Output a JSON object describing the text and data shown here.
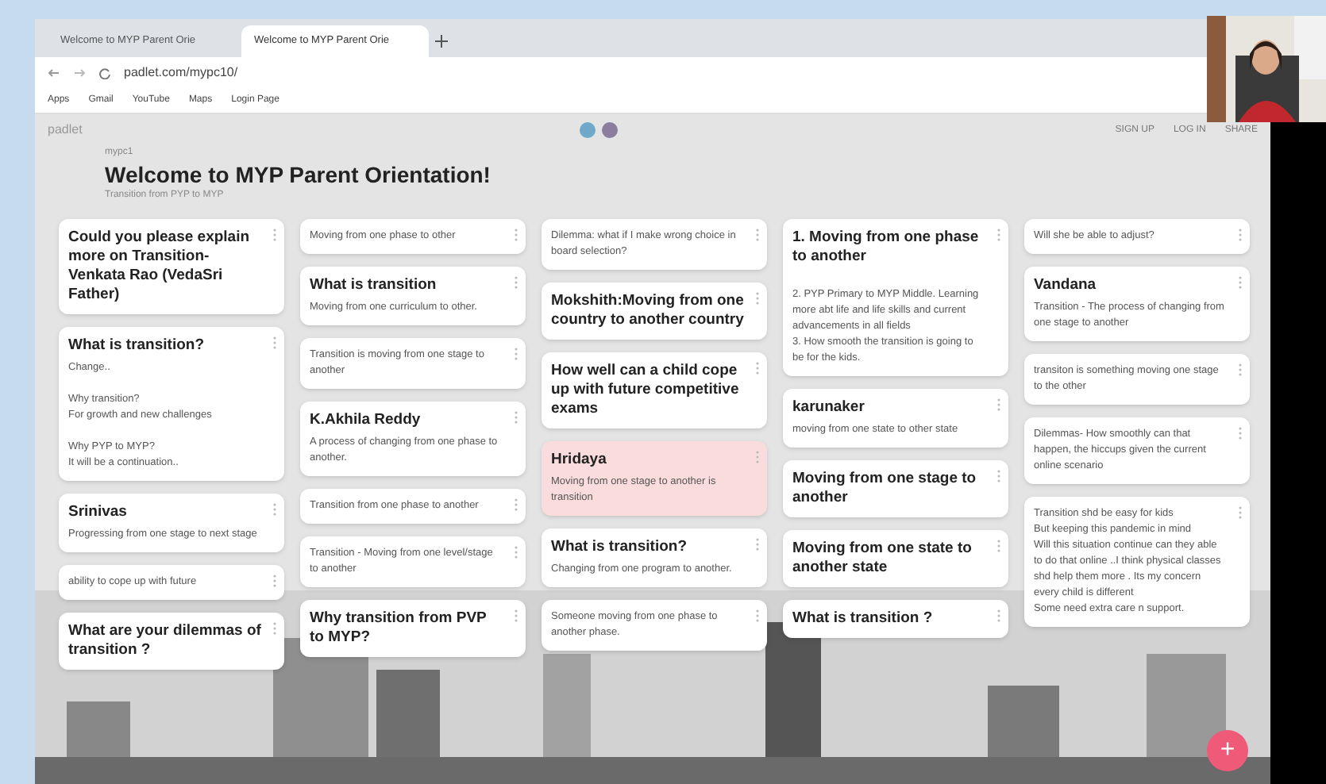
{
  "browser": {
    "tabs": [
      {
        "title": "Welcome to MYP Parent Orie",
        "selected": false
      },
      {
        "title": "Welcome to MYP Parent Orie",
        "selected": true
      }
    ],
    "address": "padlet.com/mypc10/",
    "bookmarks": [
      "Apps",
      "Gmail",
      "YouTube",
      "Maps",
      "Login Page"
    ]
  },
  "padlet": {
    "brand": "padlet",
    "actions": [
      "SIGN UP",
      "LOG IN",
      "SHARE"
    ],
    "author": "mypc1",
    "title": "Welcome to MYP Parent Orientation!",
    "subtitle": "Transition from PYP to MYP",
    "columns": [
      [
        {
          "title": "Could you please explain more on Transition-Venkata Rao (VedaSri Father)",
          "color": "#ffffff"
        },
        {
          "title": "What is transition?",
          "body": "Change..\n\nWhy transition?\nFor growth and new challenges\n\nWhy PYP to MYP?\nIt will be a continuation..",
          "color": "#ffffff"
        },
        {
          "title": "Srinivas",
          "body": "Progressing from one stage to next stage",
          "color": "#ffffff"
        },
        {
          "body": "ability to cope up with future",
          "color": "#ffffff"
        },
        {
          "title": "What are your dilemmas of transition ?",
          "color": "#ffffff"
        }
      ],
      [
        {
          "body": "Moving from one phase to other",
          "color": "#ffffff"
        },
        {
          "title": "What is transition",
          "body": "Moving from one curriculum to other.",
          "color": "#ffffff"
        },
        {
          "body": "Transition is moving from one stage to another",
          "color": "#ffffff"
        },
        {
          "title": "K.Akhila Reddy",
          "body": "A process of changing from one phase to another.",
          "color": "#ffffff"
        },
        {
          "body": "Transition from one phase to another",
          "color": "#ffffff"
        },
        {
          "body": "Transition - Moving from one level/stage to another",
          "color": "#ffffff"
        },
        {
          "title": "Why transition from PVP to MYP?",
          "color": "#ffffff"
        }
      ],
      [
        {
          "body": "Dilemma: what if I make wrong choice in board selection?",
          "color": "#ffffff"
        },
        {
          "title": "Mokshith:Moving from one country to another country",
          "color": "#ffffff"
        },
        {
          "title": "How well can a child cope up with future competitive exams",
          "color": "#ffffff"
        },
        {
          "title": "Hridaya",
          "body": "Moving from one stage to another is transition",
          "color": "#fbdcdc"
        },
        {
          "title": "What is transition?",
          "body": "Changing from one program to another.",
          "color": "#ffffff"
        },
        {
          "body": "Someone moving from one phase to another phase.",
          "color": "#ffffff"
        }
      ],
      [
        {
          "title": "1. Moving from one phase to another",
          "body": "\n2.  PYP Primary to MYP Middle. Learning more abt life and life skills and current advancements in all fields\n3. How smooth the transition is going to be for the kids.",
          "color": "#ffffff"
        },
        {
          "title": "karunaker",
          "body": "moving from one state to other state",
          "color": "#ffffff"
        },
        {
          "title": "Moving from one stage to another",
          "color": "#ffffff"
        },
        {
          "title": "Moving from one state to another state",
          "color": "#ffffff"
        },
        {
          "title": "What is transition ?",
          "color": "#ffffff"
        }
      ],
      [
        {
          "body": "Will she be able to adjust?",
          "color": "#ffffff"
        },
        {
          "title": "Vandana",
          "body": "Transition - The process of changing from one stage to another",
          "color": "#ffffff"
        },
        {
          "body": "transiton is something moving one stage to the other",
          "color": "#ffffff"
        },
        {
          "body": "Dilemmas- How smoothly can that happen, the hiccups given the current online scenario",
          "color": "#ffffff"
        },
        {
          "body": "Transition shd be easy for kids\nBut keeping this pandemic in mind\nWill this situation continue can they able to do that online ..I think physical classes shd help them more . Its my concern every child is different\nSome need extra care n support.",
          "color": "#ffffff"
        }
      ]
    ],
    "fab": "+"
  }
}
